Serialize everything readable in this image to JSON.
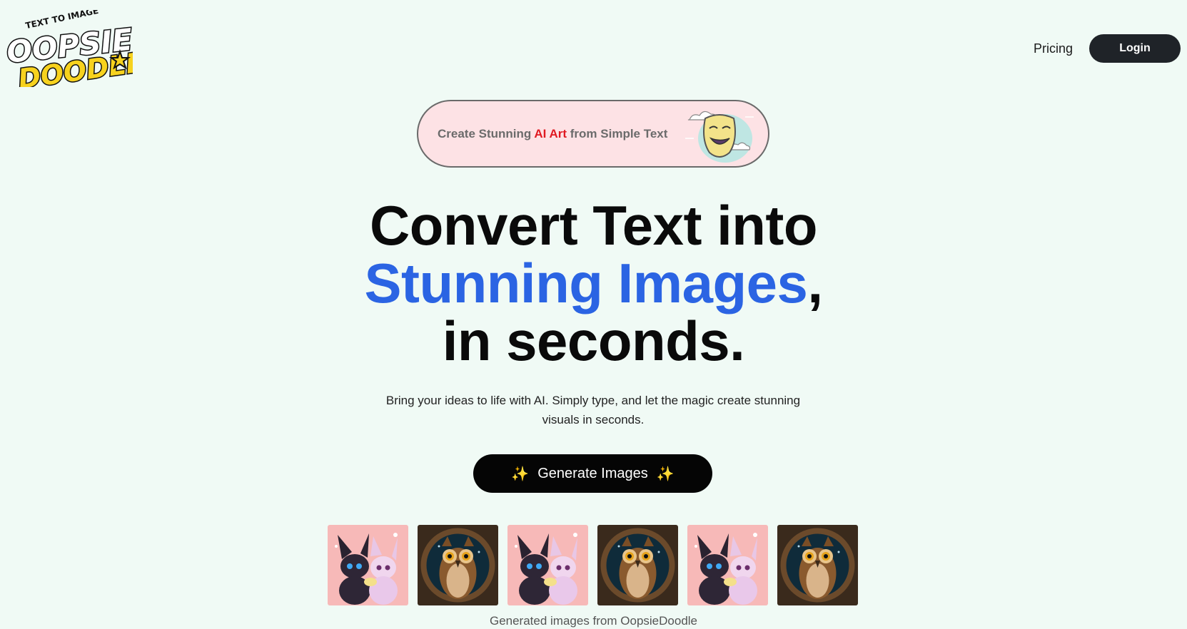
{
  "header": {
    "logo": {
      "tagline": "TEXT TO IMAGE",
      "word1": "OOPSIE",
      "word2": "DOODLE"
    },
    "nav": {
      "pricing_label": "Pricing",
      "login_label": "Login"
    }
  },
  "announcement": {
    "text_before": "Create Stunning ",
    "text_accent": "AI Art",
    "text_after": " from Simple Text",
    "icon": "smiling-mask-icon"
  },
  "hero": {
    "line1": "Convert Text into",
    "line2_highlight": "Stunning Images",
    "line2_suffix": ",",
    "line3": "in seconds."
  },
  "subtitle": "Bring your ideas to life with AI. Simply type, and let the magic create stunning visuals in seconds.",
  "cta": {
    "label": "Generate Images",
    "icon": "sparkles-icon",
    "sparkle": "✨"
  },
  "gallery": {
    "items": [
      {
        "subject": "eevee-pair"
      },
      {
        "subject": "owl"
      },
      {
        "subject": "eevee-pair"
      },
      {
        "subject": "owl"
      },
      {
        "subject": "eevee-pair"
      },
      {
        "subject": "owl"
      }
    ],
    "caption": "Generated images from OopsieDoodle"
  },
  "colors": {
    "background": "#f0faf5",
    "accent_blue": "#2b64e3",
    "accent_red": "#e01a22",
    "pill_bg": "#fde2e5",
    "logo_yellow": "#f7d21e"
  }
}
